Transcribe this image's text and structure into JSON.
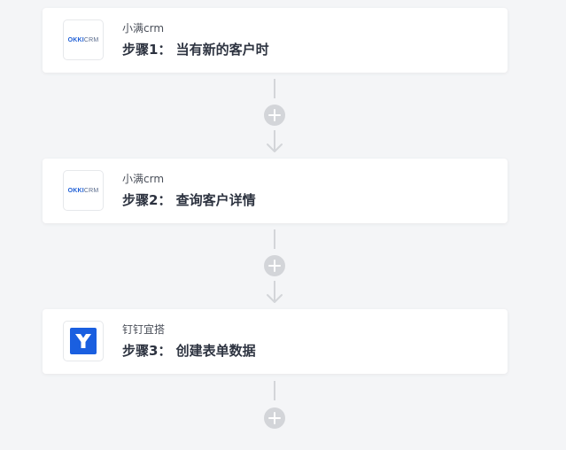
{
  "flow": {
    "steps": [
      {
        "app_name": "小满crm",
        "title": "步骤1： 当有新的客户时",
        "logo": {
          "icon": "okki-crm-logo",
          "text_strong": "OKKI",
          "text_light": "CRM"
        }
      },
      {
        "app_name": "小满crm",
        "title": "步骤2： 查询客户详情",
        "logo": {
          "icon": "okki-crm-logo",
          "text_strong": "OKKI",
          "text_light": "CRM"
        }
      },
      {
        "app_name": "钉钉宜搭",
        "title": "步骤3： 创建表单数据",
        "logo": {
          "icon": "yida-logo"
        }
      }
    ],
    "add_step_icon": "plus-circle-icon",
    "arrow_icon": "arrow-down-icon"
  },
  "colors": {
    "background": "#f4f5f7",
    "card": "#ffffff",
    "connector": "#d3d5d9",
    "okki_blue": "#1f5fd6",
    "yida_blue": "#1a5fe0",
    "title_text": "#2d3340"
  }
}
